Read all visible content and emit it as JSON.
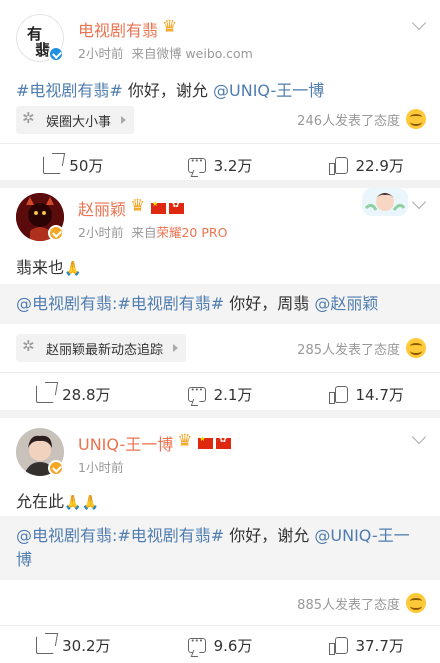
{
  "posts": [
    {
      "author": "电视剧有翡",
      "time": "2小时前",
      "source": "来自微博 weibo.com",
      "text_link": "#电视剧有翡#",
      "text_body": " 你好，谢允 ",
      "text_mention": "@UNIQ-王一博",
      "topic": "娱圈大小事",
      "attitude": "246人发表了态度",
      "shares": "50万",
      "comments": "3.2万",
      "likes": "22.9万"
    },
    {
      "author": "赵丽颖",
      "time": "2小时前",
      "source_prefix": "来自",
      "device": "荣耀20 PRO",
      "text": "翡来也",
      "repost_link": "@电视剧有翡:#电视剧有翡#",
      "repost_body": " 你好，周翡 ",
      "repost_mention": "@赵丽颖",
      "topic": "赵丽颖最新动态追踪",
      "attitude": "285人发表了态度",
      "shares": "28.8万",
      "comments": "2.1万",
      "likes": "14.7万"
    },
    {
      "author": "UNIQ-王一博",
      "time": "1小时前",
      "text": "允在此",
      "repost_link": "@电视剧有翡:#电视剧有翡#",
      "repost_body": " 你好，谢允 ",
      "repost_mention": "@UNIQ-王一博",
      "attitude": "885人发表了态度",
      "shares": "30.2万",
      "comments": "9.6万",
      "likes": "37.7万"
    }
  ],
  "icons": {
    "share": "share-icon",
    "comment": "comment-icon",
    "like": "like-icon",
    "more": "chevron-down-icon",
    "attitude": "smile-emoji-icon",
    "topic": "topic-pinwheel-icon"
  },
  "colors": {
    "name": "#eb7350",
    "link": "#507daf",
    "meta": "#999999",
    "verified": "#f5a623"
  }
}
